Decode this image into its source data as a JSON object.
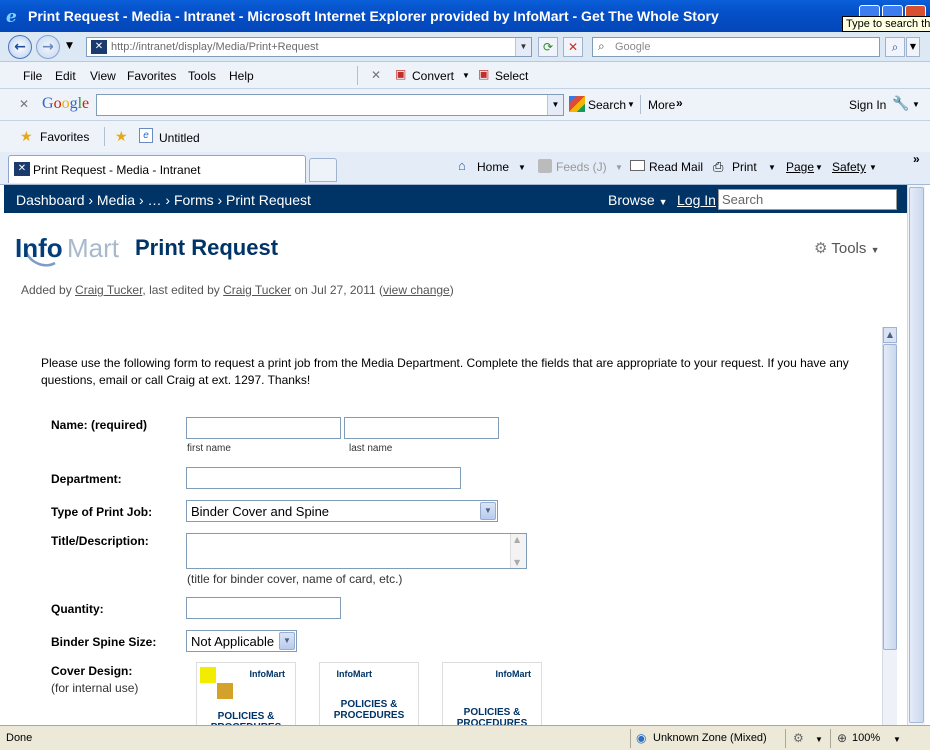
{
  "window": {
    "title": "Print Request - Media - Intranet - Microsoft Internet Explorer provided by InfoMart - Get The Whole Story",
    "tooltip": "Type to search th"
  },
  "address_bar": {
    "url": "http://intranet/display/Media/Print+Request",
    "search_placeholder": "Google"
  },
  "menu": {
    "file": "File",
    "edit": "Edit",
    "view": "View",
    "favorites": "Favorites",
    "tools": "Tools",
    "help": "Help",
    "convert": "Convert",
    "select": "Select"
  },
  "google_toolbar": {
    "logo": "Google",
    "search": "Search",
    "more": "More",
    "sign_in": "Sign In"
  },
  "favorites_bar": {
    "favorites": "Favorites",
    "untitled": "Untitled"
  },
  "tabs": {
    "active": "Print Request - Media - Intranet"
  },
  "command_bar": {
    "home": "Home",
    "feeds": "Feeds (J)",
    "read_mail": "Read Mail",
    "print": "Print",
    "page": "Page",
    "safety": "Safety"
  },
  "wiki_nav": {
    "breadcrumb": "Dashboard  ›  Media  ›  …  ›  Forms  ›  Print Request",
    "browse": "Browse",
    "login": "Log In",
    "search_placeholder": "Search"
  },
  "page": {
    "logo": "InfoMart",
    "title": "Print Request",
    "tools": "Tools",
    "meta_added_by": "Added by ",
    "meta_author": "Craig Tucker",
    "meta_edited": ", last edited by ",
    "meta_editor": "Craig Tucker",
    "meta_on": " on Jul 27, 2011  (",
    "meta_view_change": "view change",
    "meta_close": ")"
  },
  "form": {
    "intro": "Please use the following form to request a print job from the Media Department. Complete the fields that are appropriate to your request. If you have any questions, email or call Craig at ext. 1297. Thanks!",
    "name_label": "Name: (required)",
    "first_name_hint": "first name",
    "last_name_hint": "last name",
    "department_label": "Department:",
    "print_job_label": "Type of Print Job:",
    "print_job_value": "Binder Cover and Spine",
    "title_label": "Title/Description:",
    "title_hint": "(title for binder cover, name of card, etc.)",
    "quantity_label": "Quantity:",
    "spine_label": "Binder Spine Size:",
    "spine_value": "Not Applicable",
    "cover_label": "Cover Design:",
    "cover_sub": "(for internal use)",
    "cover_options": [
      {
        "brand": "InfoMart",
        "title": "POLICIES &\nPROCEDURES"
      },
      {
        "brand": "InfoMart",
        "title": "POLICIES &\nPROCEDURES"
      },
      {
        "brand": "InfoMart",
        "title": "POLICIES &\nPROCEDURES"
      }
    ]
  },
  "status_bar": {
    "status": "Done",
    "zone": "Unknown Zone (Mixed)",
    "zoom": "100%"
  }
}
